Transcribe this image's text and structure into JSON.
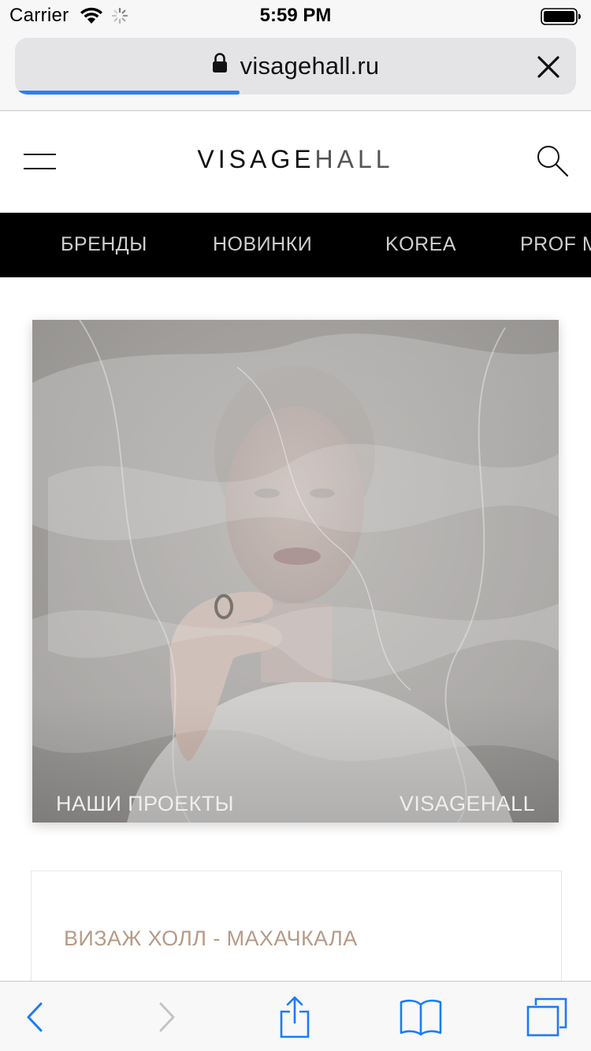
{
  "status_bar": {
    "carrier": "Carrier",
    "time": "5:59 PM",
    "wifi_icon": "wifi-icon",
    "activity_icon": "loading-spinner-icon",
    "battery_icon": "battery-icon"
  },
  "browser": {
    "url": "visagehall.ru",
    "secure_icon": "lock-icon",
    "close_icon": "close-icon",
    "load_progress": 0.4,
    "accent_color": "#2a7ff5"
  },
  "site_header": {
    "menu_icon": "hamburger-menu-icon",
    "logo_part1": "VISAGE",
    "logo_part2": "HALL",
    "search_icon": "search-icon"
  },
  "nav": {
    "items": [
      {
        "label": "БРЕНДЫ"
      },
      {
        "label": "НОВИНКИ"
      },
      {
        "label": "KOREA"
      },
      {
        "label": "PROF M"
      }
    ]
  },
  "hero": {
    "caption_left": "НАШИ ПРОЕКТЫ",
    "caption_right": "VISAGEHALL"
  },
  "store_card": {
    "title": "ВИЗАЖ ХОЛЛ - МАХАЧКАЛА",
    "title_color": "#b79a86"
  },
  "toolbar": {
    "back_icon": "back-chevron-icon",
    "forward_icon": "forward-chevron-icon",
    "share_icon": "share-icon",
    "bookmarks_icon": "bookmarks-book-icon",
    "tabs_icon": "tabs-icon",
    "accent_color": "#1a7cf5"
  }
}
